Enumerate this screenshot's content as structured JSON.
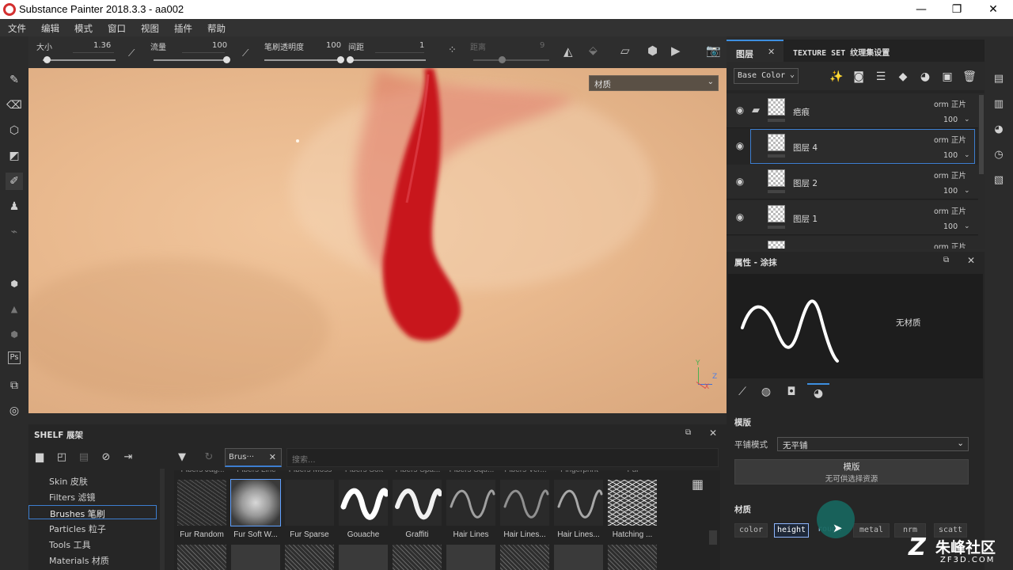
{
  "window": {
    "title": "Substance Painter 2018.3.3 - aa002"
  },
  "menu": [
    "文件",
    "编辑",
    "模式",
    "窗口",
    "视图",
    "插件",
    "帮助"
  ],
  "tool_options": {
    "size": {
      "label": "大小",
      "value": "1.36",
      "fraction": 0.05
    },
    "flow": {
      "label": "流量",
      "value": "100",
      "fraction": 1.0
    },
    "opacity": {
      "label": "笔刷透明度",
      "value": "100",
      "fraction": 1.0
    },
    "spacing": {
      "label": "间距",
      "value": "1",
      "fraction": 0.0
    },
    "distance": {
      "label": "距离",
      "value": "9"
    }
  },
  "viewport": {
    "material_select": "材质",
    "axis": {
      "y": "Y",
      "z": "Z",
      "x": "X"
    }
  },
  "layers": {
    "tabs": [
      "图层",
      "TEXTURE SET 纹理集设置"
    ],
    "channel": "Base Color",
    "items": [
      {
        "name": "疤痕",
        "blend": "orm 正片",
        "opacity": "100"
      },
      {
        "name": "图层 4",
        "blend": "orm 正片",
        "opacity": "100"
      },
      {
        "name": "图层 2",
        "blend": "orm 正片",
        "opacity": "100"
      },
      {
        "name": "图层 1",
        "blend": "orm 正片",
        "opacity": "100"
      }
    ],
    "partial_blend": "orm 正片"
  },
  "properties": {
    "title": "属性 - 涂抹",
    "no_material": "无材质",
    "stencil_section": "模版",
    "tiling_label": "平铺模式",
    "tiling_value": "无平铺",
    "stencil_button": "模版",
    "stencil_sub": "无可供选择资源",
    "material_section": "材质",
    "channels": [
      "color",
      "height",
      "rough",
      "metal",
      "nrm",
      "scatt"
    ]
  },
  "shelf": {
    "title": "SHELF 展架",
    "filter_chip": "Brus···",
    "search_placeholder": "搜索...",
    "categories": [
      "Skin 皮肤",
      "Filters 滤镜",
      "Brushes 笔刷",
      "Particles 粒子",
      "Tools 工具",
      "Materials 材质"
    ],
    "selected_category": "Brushes 笔刷",
    "top_row_labels": [
      "Fibers Jag...",
      "Fibers Line",
      "Fibers Moss",
      "Fibers Soft",
      "Fibers Spa...",
      "Fibers Squ...",
      "Fibers Ver...",
      "Fingerprint",
      "Fur"
    ],
    "brushes": [
      "Fur Random",
      "Fur Soft W...",
      "Fur Sparse",
      "Gouache",
      "Graffiti",
      "Hair Lines",
      "Hair Lines...",
      "Hair Lines...",
      "Hatching ..."
    ]
  },
  "watermark": {
    "text": "朱峰社区",
    "url": "ZF3D.COM"
  }
}
